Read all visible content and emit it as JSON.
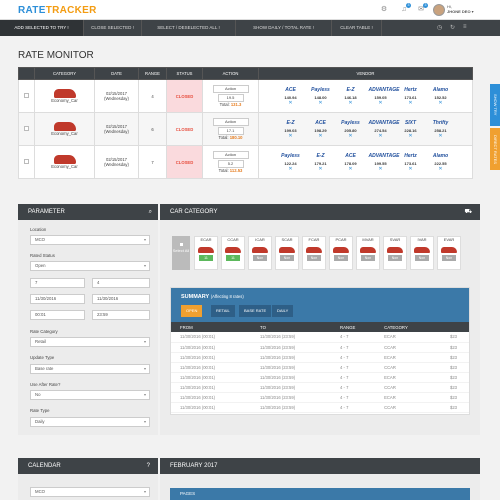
{
  "brand": {
    "part1": "RATE",
    "part2": "TRACKER"
  },
  "header": {
    "notif_count": "3",
    "msg_count": "3",
    "user_greeting": "Hi,",
    "user_name": "JHONE DEO"
  },
  "toolbar": {
    "buttons": [
      "ADD SELECTED TO TRY !",
      "CLOSE SELECTED !",
      "SELECT / DESELECTED ALL !",
      "SHOW DAILY / TOTAL RATE !",
      "CLEAR TABLE !"
    ]
  },
  "page": {
    "title": "RATE MONITOR"
  },
  "grid": {
    "headers": [
      "CATEGORY",
      "DATE",
      "RANGE",
      "STATUS",
      "ACTION",
      "VENDOR"
    ],
    "rows": [
      {
        "category": "Economy_Car",
        "date": "02/15/2017",
        "day": "(Wednesday)",
        "range": "4",
        "status": "CLOSED",
        "action": "Action",
        "qty": "19.5",
        "total_label": "Total:",
        "total": "131.3",
        "vendors": [
          {
            "name": "ACE",
            "price": "140.94"
          },
          {
            "name": "Payless",
            "price": "148.00"
          },
          {
            "name": "E-Z",
            "price": "146.18"
          },
          {
            "name": "ADVANTAGE",
            "price": "159.05"
          },
          {
            "name": "Hertz",
            "price": "173.61"
          },
          {
            "name": "Alamo",
            "price": "152.52"
          }
        ]
      },
      {
        "category": "Economy_Car",
        "date": "02/15/2017",
        "day": "(Wednesday)",
        "range": "6",
        "status": "CLOSED",
        "action": "Action",
        "qty": "17.1",
        "total_label": "Total:",
        "total": "180.10",
        "vendors": [
          {
            "name": "E-Z",
            "price": "199.03"
          },
          {
            "name": "ACE",
            "price": "198.29"
          },
          {
            "name": "Payless",
            "price": "205.80"
          },
          {
            "name": "ADVANTAGE",
            "price": "274.54"
          },
          {
            "name": "SIXT",
            "price": "228.16"
          },
          {
            "name": "Thrifty",
            "price": "258.21"
          }
        ]
      },
      {
        "category": "Economy_Car",
        "date": "02/15/2017",
        "day": "(Wednesday)",
        "range": "7",
        "status": "CLOSED",
        "action": "Action",
        "qty": "5.2",
        "total_label": "Total:",
        "total": "112.53",
        "vendors": [
          {
            "name": "Payless",
            "price": "122.24"
          },
          {
            "name": "E-Z",
            "price": "179.21"
          },
          {
            "name": "ACE",
            "price": "178.09"
          },
          {
            "name": "ADVANTAGE",
            "price": "199.55"
          },
          {
            "name": "Hertz",
            "price": "173.61"
          },
          {
            "name": "Alamo",
            "price": "222.55"
          }
        ]
      }
    ]
  },
  "side_tabs": [
    "SHOW TRY",
    "DIRECT RATES"
  ],
  "parameter": {
    "title": "PARAMETER",
    "location_label": "Location",
    "location": "MCO",
    "rated_status_label": "Rated Status",
    "rated_status": "Open",
    "n1": "7",
    "n2": "4",
    "date1": "11/30/2016",
    "date2": "11/30/2016",
    "time1": "00:01",
    "time2": "23:59",
    "rate_category_label": "Rate Category",
    "rate_category": "Retail",
    "update_type_label": "Update Type",
    "update_type": "Base rate",
    "use_after_label": "Use After Rate?",
    "use_after": "No",
    "rate_type_label": "Rate Type",
    "rate_type": "Daily"
  },
  "car_category": {
    "title": "CAR CATEGORY",
    "select_all": "Select All",
    "cars": [
      {
        "code": "ECAR",
        "tag": "11",
        "green": true
      },
      {
        "code": "CCAR",
        "tag": "11",
        "green": true
      },
      {
        "code": "ICAR",
        "tag": "Non",
        "green": false
      },
      {
        "code": "SCAR",
        "tag": "Non",
        "green": false
      },
      {
        "code": "FCAR",
        "tag": "Non",
        "green": false
      },
      {
        "code": "PCAR",
        "tag": "Non",
        "green": false
      },
      {
        "code": "MVAR",
        "tag": "Non",
        "green": false
      },
      {
        "code": "SVAR",
        "tag": "Non",
        "green": false
      },
      {
        "code": "IVAR",
        "tag": "Non",
        "green": false
      },
      {
        "code": "EVAR",
        "tag": "Non",
        "green": false
      }
    ]
  },
  "summary": {
    "title": "SUMMARY",
    "subtitle": "(Affecting 8 rates)",
    "buttons": [
      "OPEN",
      "RETAIL",
      "BASE RATE",
      "DAILY"
    ],
    "headers": [
      "FROM",
      "TO",
      "RANGE",
      "CATEGORY"
    ],
    "rows": [
      [
        "11/30/2016 (00:01)",
        "11/30/2016 (23:59)",
        "4 - 7",
        "ECAR",
        "$23"
      ],
      [
        "11/30/2016 (00:01)",
        "11/30/2016 (23:59)",
        "4 - 7",
        "CCAR",
        "$23"
      ],
      [
        "11/30/2016 (00:01)",
        "11/30/2016 (23:59)",
        "4 - 7",
        "ECAR",
        "$23"
      ],
      [
        "11/30/2016 (00:01)",
        "11/30/2016 (23:59)",
        "4 - 7",
        "CCAR",
        "$23"
      ],
      [
        "11/30/2016 (00:01)",
        "11/30/2016 (23:59)",
        "4 - 7",
        "ECAR",
        "$23"
      ],
      [
        "11/30/2016 (00:01)",
        "11/30/2016 (23:59)",
        "4 - 7",
        "CCAR",
        "$23"
      ],
      [
        "11/30/2016 (00:01)",
        "11/30/2016 (23:59)",
        "4 - 7",
        "ECAR",
        "$23"
      ],
      [
        "11/30/2016 (00:01)",
        "11/30/2016 (23:59)",
        "4 - 7",
        "CCAR",
        "$23"
      ]
    ]
  },
  "calendar": {
    "title": "CALENDAR",
    "help": "?",
    "location": "MCO",
    "month": "FEBRUARY 2017",
    "pages": "PAGES"
  }
}
